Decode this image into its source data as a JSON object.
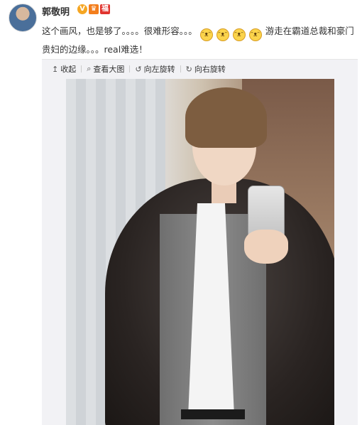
{
  "user": {
    "name": "郭敬明"
  },
  "post": {
    "text_part1": "这个画风，也是够了。。。。很难形容。。。",
    "emoji_count": 4,
    "text_part2": "游走在霸道总裁和豪门贵妇的边缘。。。real难选！"
  },
  "toolbar": {
    "collapse_label": "收起",
    "view_large_label": "查看大图",
    "rotate_left_label": "向左旋转",
    "rotate_right_label": "向右旋转"
  }
}
